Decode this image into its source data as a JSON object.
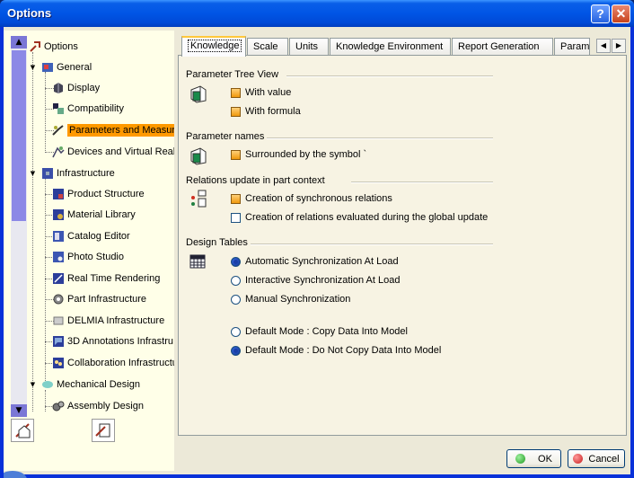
{
  "window": {
    "title": "Options",
    "help_label": "?",
    "close_label": "✕"
  },
  "tree": {
    "scroll_up": "▲",
    "scroll_down": "▼",
    "items": [
      {
        "label": "Options",
        "level": 0
      },
      {
        "label": "General",
        "level": 1
      },
      {
        "label": "Display",
        "level": 2
      },
      {
        "label": "Compatibility",
        "level": 2
      },
      {
        "label": "Parameters and Measure",
        "level": 2,
        "selected": true
      },
      {
        "label": "Devices and Virtual Realit",
        "level": 2
      },
      {
        "label": "Infrastructure",
        "level": 1
      },
      {
        "label": "Product Structure",
        "level": 2
      },
      {
        "label": "Material Library",
        "level": 2
      },
      {
        "label": "Catalog Editor",
        "level": 2
      },
      {
        "label": "Photo Studio",
        "level": 2
      },
      {
        "label": "Real Time Rendering",
        "level": 2
      },
      {
        "label": "Part Infrastructure",
        "level": 2
      },
      {
        "label": "DELMIA Infrastructure",
        "level": 2
      },
      {
        "label": "3D Annotations Infrastru",
        "level": 2
      },
      {
        "label": "Collaboration Infrastructu",
        "level": 2
      },
      {
        "label": "Mechanical Design",
        "level": 1
      },
      {
        "label": "Assembly Design",
        "level": 2
      }
    ]
  },
  "tabs": [
    {
      "label": "Knowledge",
      "active": true
    },
    {
      "label": "Scale"
    },
    {
      "label": "Units"
    },
    {
      "label": "Knowledge Environment"
    },
    {
      "label": "Report Generation"
    },
    {
      "label": "Parame"
    }
  ],
  "tab_scroll": {
    "left": "◀",
    "right": "▶"
  },
  "groups": {
    "tree_view": {
      "title": "Parameter Tree View",
      "with_value": "With value",
      "with_formula": "With formula"
    },
    "names": {
      "title": "Parameter names",
      "surrounded": "Surrounded by the symbol `"
    },
    "relations": {
      "title": "Relations update in part context",
      "synchronous": "Creation of synchronous relations",
      "global": "Creation of relations evaluated during the global update"
    },
    "design_tables": {
      "title": "Design Tables",
      "auto_sync": "Automatic Synchronization At Load",
      "interactive_sync": "Interactive Synchronization At Load",
      "manual_sync": "Manual Synchronization",
      "copy_mode": "Default Mode : Copy Data Into Model",
      "no_copy_mode": "Default Mode : Do Not Copy Data Into Model"
    }
  },
  "buttons": {
    "ok": "OK",
    "cancel": "Cancel"
  },
  "colors": {
    "selection": "#ff9900",
    "titlebar": "#0055e5",
    "ok_dot": "#22a022",
    "cancel_dot": "#d02020"
  }
}
